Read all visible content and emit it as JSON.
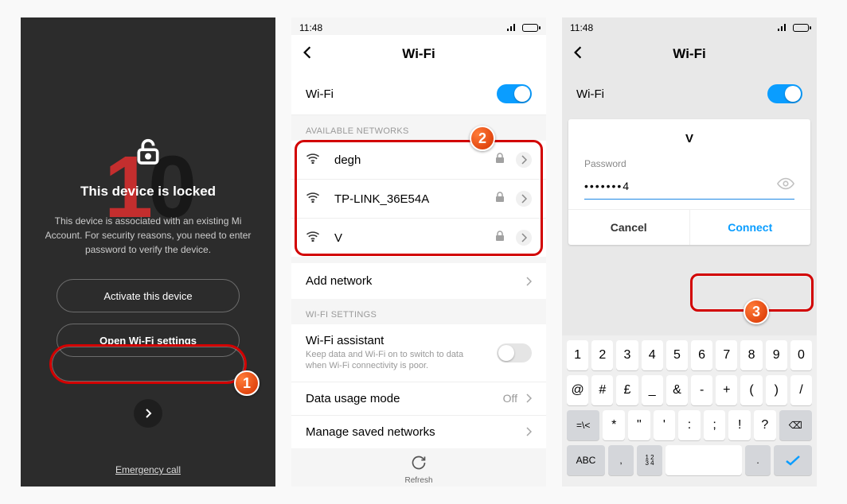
{
  "screen1": {
    "bg_brand": "10",
    "locked_title": "This device is locked",
    "locked_desc": "This device is associated with an existing Mi Account. For security reasons, you need to enter password to verify the device.",
    "btn_activate": "Activate this device",
    "btn_open_wifi": "Open Wi-Fi settings",
    "emergency": "Emergency call"
  },
  "screen2": {
    "time": "11:48",
    "header": "Wi-Fi",
    "wifi_label": "Wi-Fi",
    "wifi_on": true,
    "section_available": "AVAILABLE NETWORKS",
    "networks": [
      {
        "name": "degh",
        "locked": true
      },
      {
        "name": "TP-LINK_36E54A",
        "locked": true
      },
      {
        "name": "V",
        "locked": true
      }
    ],
    "add_network": "Add network",
    "section_settings": "WI-FI SETTINGS",
    "assistant_title": "Wi-Fi assistant",
    "assistant_sub": "Keep data and Wi-Fi on to switch to data when Wi-Fi connectivity is poor.",
    "data_usage_label": "Data usage mode",
    "data_usage_value": "Off",
    "manage_saved": "Manage saved networks",
    "refresh": "Refresh"
  },
  "screen3": {
    "time": "11:48",
    "header": "Wi-Fi",
    "wifi_label": "Wi-Fi",
    "dialog": {
      "ssid": "V",
      "password_label": "Password",
      "password_value": "•••••••4",
      "cancel": "Cancel",
      "connect": "Connect"
    },
    "keyboard": {
      "row1": [
        "1",
        "2",
        "3",
        "4",
        "5",
        "6",
        "7",
        "8",
        "9",
        "0"
      ],
      "row2": [
        "@",
        "#",
        "£",
        "_",
        "&",
        "-",
        "+",
        "(",
        ")",
        "/"
      ],
      "row3_shift": "=\\<",
      "row3": [
        "*",
        "\"",
        "'",
        ":",
        ";",
        "!",
        "?"
      ],
      "row3_del": "⌫",
      "row4_abc": "ABC",
      "row4_comma": ",",
      "row4_nums": "1234",
      "row4_space": " ",
      "row4_dot": ".",
      "row4_enter": "✓"
    }
  },
  "badges": {
    "b1": "1",
    "b2": "2",
    "b3": "3"
  }
}
